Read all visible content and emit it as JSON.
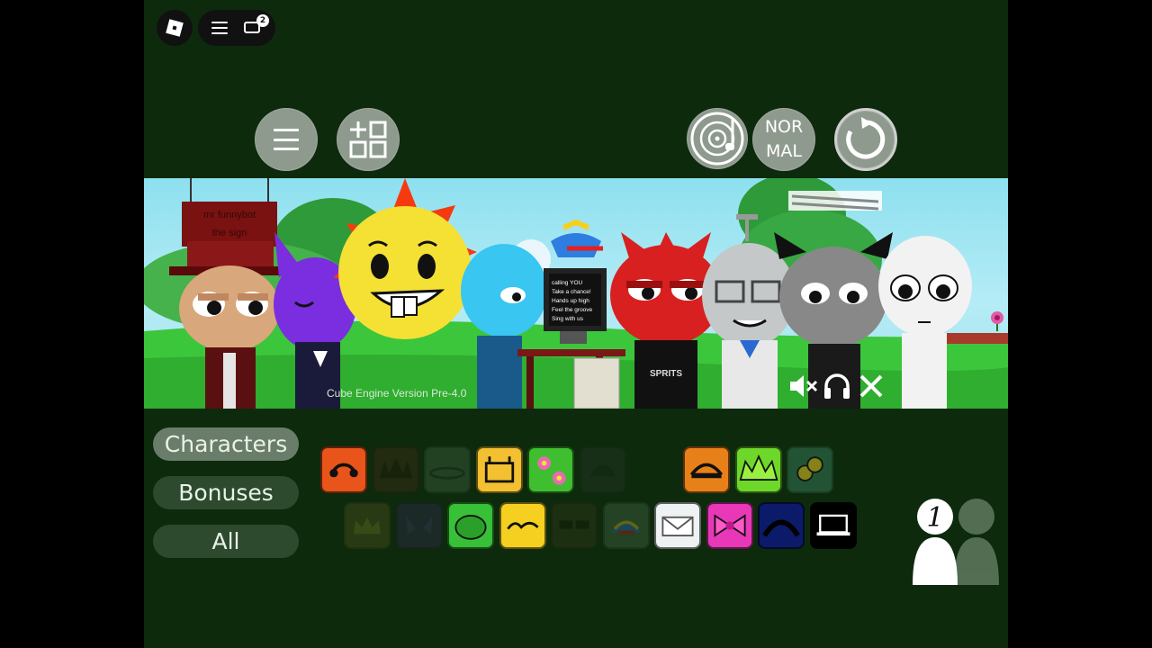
{
  "topbar": {
    "chat_badge": "2"
  },
  "controls": {
    "mode_line1": "NOR",
    "mode_line2": "MAL"
  },
  "scene": {
    "version_text": "Cube Engine Version Pre-4.0",
    "sign_line1": "mr funnybot",
    "sign_line2": "the sign",
    "monitor_lines": [
      "calling YOU",
      "Take a chance!",
      "Hands up high",
      "Feel the groove",
      "Sing with us"
    ],
    "shirt_text": "SPRITS"
  },
  "categories": [
    "Characters",
    "Bonuses",
    "All"
  ],
  "active_category": 0,
  "icons_row1": [
    {
      "name": "orange-headset-icon",
      "bg": "#e8541a",
      "state": "active"
    },
    {
      "name": "dark-spiky-hair-icon",
      "bg": "#4a2a18",
      "state": "dim"
    },
    {
      "name": "grey-halo-icon",
      "bg": "#4a6a4a",
      "state": "dim"
    },
    {
      "name": "yellow-box-icon",
      "bg": "#f2c030",
      "state": "active"
    },
    {
      "name": "green-flowers-icon",
      "bg": "#3fbf2f",
      "state": "active"
    },
    {
      "name": "dark-helmet-icon",
      "bg": "#2a3a2a",
      "state": "dim"
    },
    {
      "name": "orange-visor-icon",
      "bg": "#e8801a",
      "state": "active"
    },
    {
      "name": "green-spikes-icon",
      "bg": "#6ed82a",
      "state": "active"
    },
    {
      "name": "teal-coins-icon",
      "bg": "#2e6a4a",
      "state": "semi"
    }
  ],
  "icons_row2": [
    {
      "name": "olive-crown-icon",
      "bg": "#5a5a20",
      "state": "dim"
    },
    {
      "name": "purple-horns-icon",
      "bg": "#352a55",
      "state": "dim"
    },
    {
      "name": "green-headphones-icon",
      "bg": "#38c038",
      "state": "active"
    },
    {
      "name": "yellow-ribbon-icon",
      "bg": "#f5d020",
      "state": "active"
    },
    {
      "name": "dark-shades-icon",
      "bg": "#3a3a1a",
      "state": "dim"
    },
    {
      "name": "propeller-cap-icon",
      "bg": "#4f6f4f",
      "state": "dim"
    },
    {
      "name": "white-envelope-icon",
      "bg": "#eef2f2",
      "state": "active"
    },
    {
      "name": "pink-bow-icon",
      "bg": "#e838b8",
      "state": "active"
    },
    {
      "name": "navy-arch-icon",
      "bg": "#0c1a6a",
      "state": "active"
    },
    {
      "name": "black-laptop-icon",
      "bg": "#000000",
      "state": "active"
    }
  ],
  "players": {
    "count": "1"
  }
}
